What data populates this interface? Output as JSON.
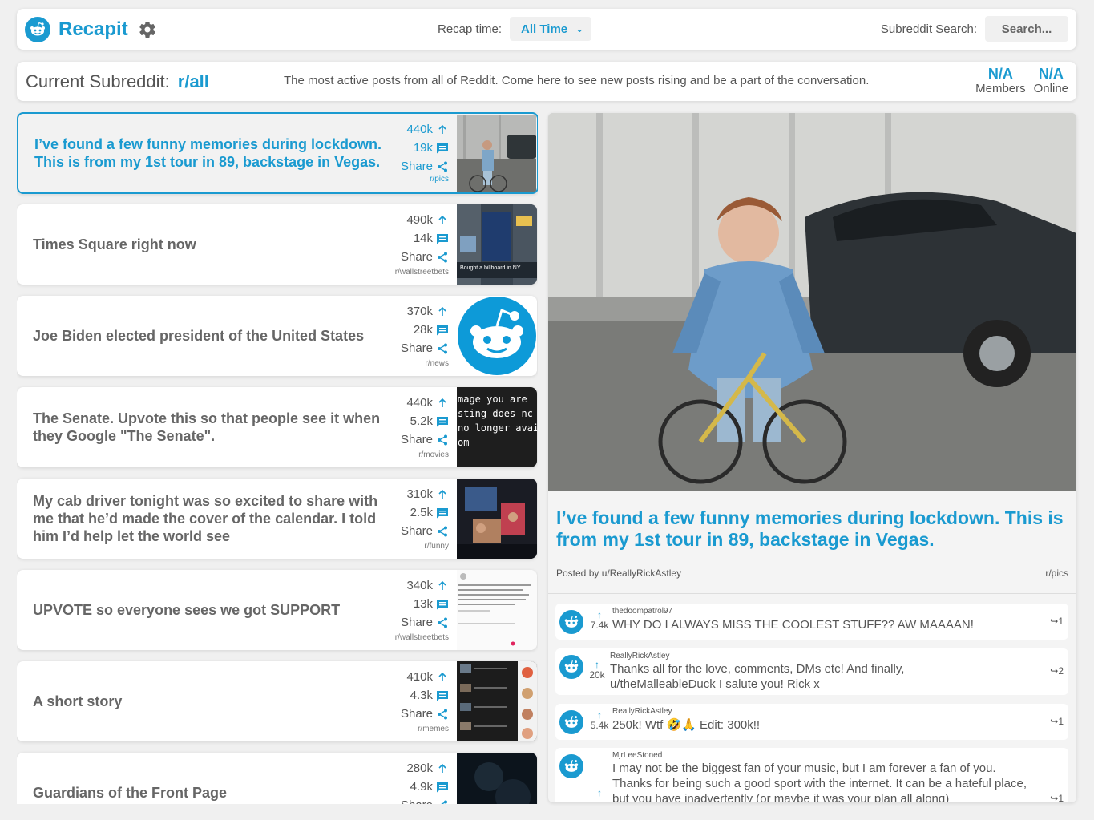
{
  "header": {
    "app_title": "Recapit",
    "recap_label": "Recap time:",
    "recap_value": "All Time",
    "search_label": "Subreddit Search:",
    "search_placeholder": "Search..."
  },
  "subreddit": {
    "prefix": "Current Subreddit:",
    "name": "r/all",
    "description": "The most active posts from all of Reddit. Come here to see new posts rising and be a part of the conversation.",
    "members_value": "N/A",
    "members_label": "Members",
    "online_value": "N/A",
    "online_label": "Online"
  },
  "colors": {
    "accent": "#1a9ad0",
    "background": "#f0f0f0"
  },
  "posts": [
    {
      "title": "I’ve found a few funny memories during lockdown. This is from my 1st tour in 89, backstage in Vegas.",
      "upvotes": "440k",
      "comments": "19k",
      "share": "Share",
      "subreddit": "r/pics",
      "thumb": "photo-cyclist"
    },
    {
      "title": "Times Square right now",
      "upvotes": "490k",
      "comments": "14k",
      "share": "Share",
      "subreddit": "r/wallstreetbets",
      "thumb": "photo-times-square",
      "thumb_caption": "Bought a billboard in NY"
    },
    {
      "title": "Joe Biden elected president of the United States",
      "upvotes": "370k",
      "comments": "28k",
      "share": "Share",
      "subreddit": "r/news",
      "thumb": "reddit-logo"
    },
    {
      "title": "The Senate. Upvote this so that people see it when they Google \"The Senate\".",
      "upvotes": "440k",
      "comments": "5.2k",
      "share": "Share",
      "subreddit": "r/movies",
      "thumb": "text-image",
      "thumb_lines": [
        "mage you are",
        "sting does nc",
        "no longer avail",
        "om"
      ]
    },
    {
      "title": "My cab driver tonight was so excited to share with me that he’d made the cover of the calendar. I told him I’d help let the world see",
      "upvotes": "310k",
      "comments": "2.5k",
      "share": "Share",
      "subreddit": "r/funny",
      "thumb": "photo-cab"
    },
    {
      "title": "UPVOTE so everyone sees we got SUPPORT",
      "upvotes": "340k",
      "comments": "13k",
      "share": "Share",
      "subreddit": "r/wallstreetbets",
      "thumb": "tweet-screenshot"
    },
    {
      "title": "A short story",
      "upvotes": "410k",
      "comments": "4.3k",
      "share": "Share",
      "subreddit": "r/memes",
      "thumb": "meme-grid"
    },
    {
      "title": "Guardians of the Front Page",
      "upvotes": "280k",
      "comments": "4.9k",
      "share": "Share",
      "subreddit": "",
      "thumb": "dark-photo"
    }
  ],
  "detail": {
    "title": "I’ve found a few funny memories during lockdown. This is from my 1st tour in 89, backstage in Vegas.",
    "author": "Posted by u/ReallyRickAstley",
    "subreddit": "r/pics",
    "comments": [
      {
        "author": "thedoompatrol97",
        "score": "7.4k",
        "text": "WHY DO I ALWAYS MISS THE COOLEST STUFF?? AW MAAAAN!",
        "replies": "1"
      },
      {
        "author": "ReallyRickAstley",
        "score": "20k",
        "text": "Thanks all for the love, comments, DMs etc! And finally, u/theMalleableDuck I salute you! Rick x",
        "replies": "2"
      },
      {
        "author": "ReallyRickAstley",
        "score": "5.4k",
        "text": "250k! Wtf 🤣🙏 Edit: 300k!!",
        "replies": "1"
      },
      {
        "author": "MjrLeeStoned",
        "score": "",
        "text": "I may not be the biggest fan of your music, but I am forever a fan of you. Thanks for being such a good sport with the internet. It can be a hateful place, but you have inadvertently (or maybe it was your plan all along)",
        "replies": "1"
      }
    ]
  }
}
